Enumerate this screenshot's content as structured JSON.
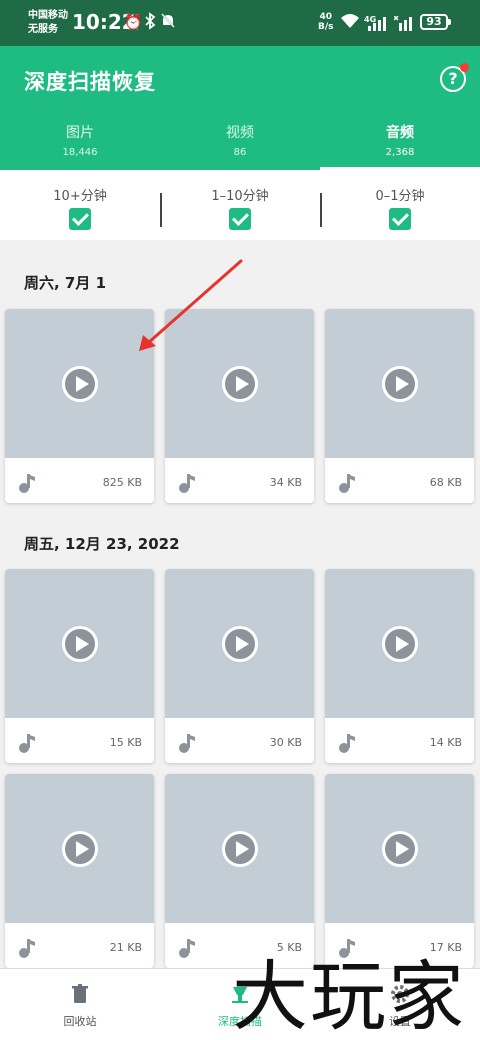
{
  "status_bar": {
    "carrier_line1": "中国移动",
    "carrier_line2": "无服务",
    "time": "10:22",
    "net_speed_value": "40",
    "net_speed_unit": "B/s",
    "network": "4G",
    "battery": "93",
    "icons": [
      "alarm-icon",
      "bluetooth-icon",
      "mute-icon",
      "wifi-icon",
      "signal-icon"
    ]
  },
  "header": {
    "title": "深度扫描恢复",
    "help_symbol": "?",
    "tabs": [
      {
        "label": "图片",
        "count": "18,446",
        "active": false
      },
      {
        "label": "视频",
        "count": "86",
        "active": false
      },
      {
        "label": "音频",
        "count": "2,368",
        "active": true
      }
    ]
  },
  "filters": [
    {
      "label": "10+分钟",
      "checked": true
    },
    {
      "label": "1–10分钟",
      "checked": true
    },
    {
      "label": "0–1分钟",
      "checked": true
    }
  ],
  "groups": [
    {
      "date": "周六, 7月 1",
      "items": [
        {
          "size": "825 KB"
        },
        {
          "size": "34 KB"
        },
        {
          "size": "68 KB"
        }
      ]
    },
    {
      "date": "周五, 12月 23, 2022",
      "items": [
        {
          "size": "15 KB"
        },
        {
          "size": "30 KB"
        },
        {
          "size": "14 KB"
        },
        {
          "size": "21 KB"
        },
        {
          "size": "5 KB"
        },
        {
          "size": "17 KB"
        }
      ]
    }
  ],
  "bottom_nav": [
    {
      "label": "回收站",
      "icon": "trash-icon",
      "active": false
    },
    {
      "label": "深度扫描",
      "icon": "drill-icon",
      "active": true
    },
    {
      "label": "设置",
      "icon": "gear-icon",
      "active": false
    }
  ],
  "watermark": "大玩家",
  "colors": {
    "accent": "#1ebc82",
    "status_bar": "#1e6b45",
    "annotation_arrow": "#e8332c"
  }
}
